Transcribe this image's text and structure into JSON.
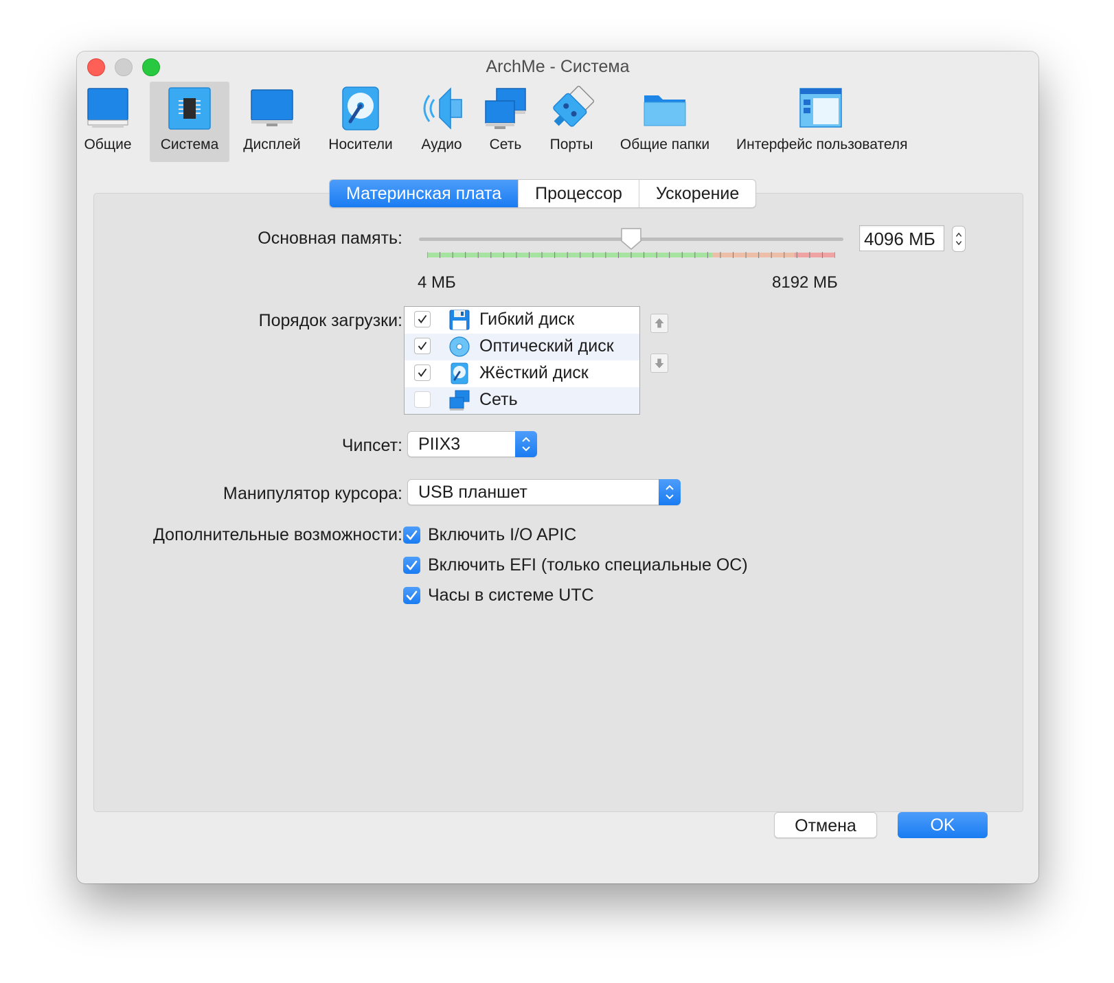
{
  "window": {
    "title": "ArchMe - Система"
  },
  "toolbar": {
    "items": [
      {
        "label": "Общие",
        "icon": "monitor-general-icon"
      },
      {
        "label": "Система",
        "icon": "chip-icon",
        "selected": true
      },
      {
        "label": "Дисплей",
        "icon": "display-icon"
      },
      {
        "label": "Носители",
        "icon": "storage-disk-icon"
      },
      {
        "label": "Аудио",
        "icon": "speaker-icon"
      },
      {
        "label": "Сеть",
        "icon": "network-icon"
      },
      {
        "label": "Порты",
        "icon": "ports-icon"
      },
      {
        "label": "Общие папки",
        "icon": "folder-icon"
      },
      {
        "label": "Интерфейс пользователя",
        "icon": "user-interface-icon"
      }
    ]
  },
  "tabs": [
    {
      "label": "Материнская плата",
      "active": true
    },
    {
      "label": "Процессор"
    },
    {
      "label": "Ускорение"
    }
  ],
  "memory": {
    "label": "Основная память:",
    "value_text": "4096 МБ",
    "value": 4096,
    "min": 4,
    "max": 8192,
    "min_label": "4 МБ",
    "max_label": "8192 МБ"
  },
  "boot_order": {
    "label": "Порядок загрузки:",
    "items": [
      {
        "label": "Гибкий диск",
        "checked": true,
        "icon": "floppy-icon"
      },
      {
        "label": "Оптический диск",
        "checked": true,
        "icon": "optical-disc-icon"
      },
      {
        "label": "Жёсткий диск",
        "checked": true,
        "icon": "hard-disk-icon"
      },
      {
        "label": "Сеть",
        "checked": false,
        "icon": "network-icon"
      }
    ]
  },
  "chipset": {
    "label": "Чипсет:",
    "value": "PIIX3"
  },
  "pointing_device": {
    "label": "Манипулятор курсора:",
    "value": "USB планшет"
  },
  "extended": {
    "label": "Дополнительные возможности:",
    "options": [
      {
        "label": "Включить I/O APIC",
        "checked": true
      },
      {
        "label": "Включить EFI (только специальные ОС)",
        "checked": true
      },
      {
        "label": "Часы в системе UTC",
        "checked": true
      }
    ]
  },
  "buttons": {
    "cancel": "Отмена",
    "ok": "OK"
  },
  "colors": {
    "accent": "#1a7cf2",
    "selected_toolbar": "#d3d3d3",
    "scale_green": "#a7e3a0",
    "scale_orange": "#eebfa8",
    "scale_red": "#f0a3a3"
  }
}
